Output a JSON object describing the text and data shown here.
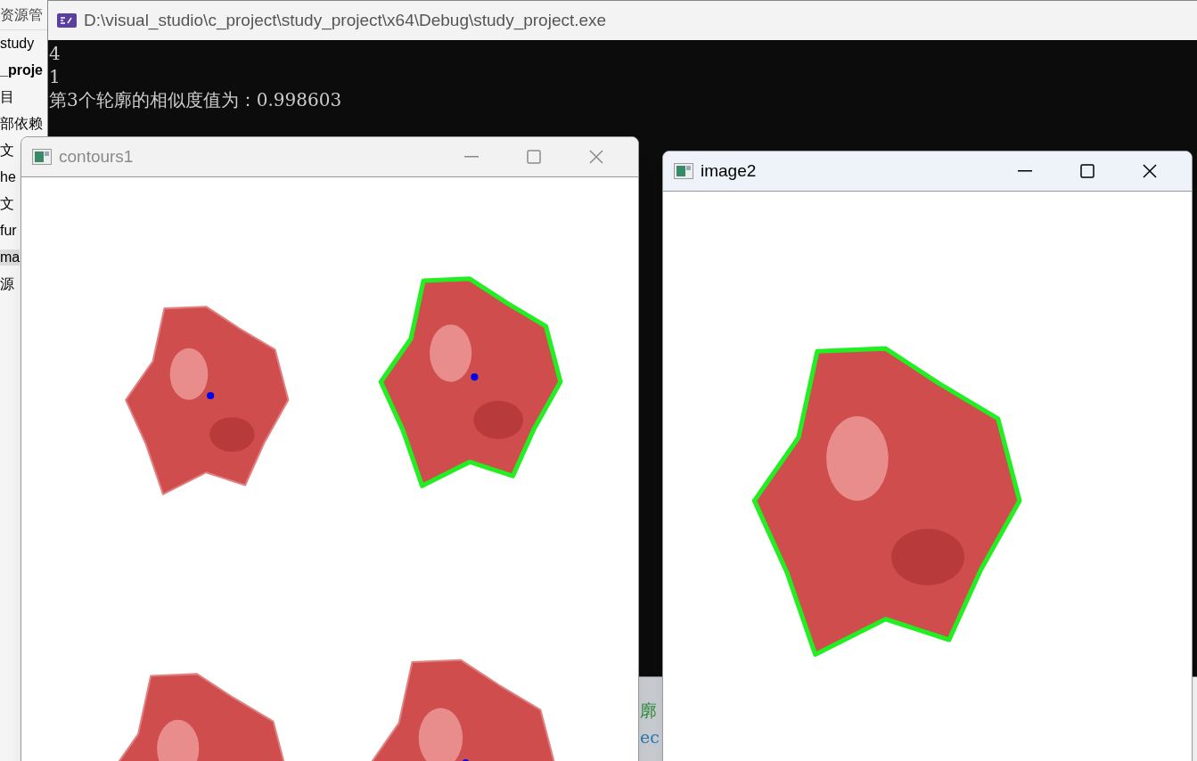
{
  "explorer": {
    "title": "资源管",
    "items": [
      {
        "label": "study",
        "bold": false,
        "selected": false
      },
      {
        "label": "_proje",
        "bold": true,
        "selected": false
      },
      {
        "label": "目",
        "bold": false,
        "selected": false
      },
      {
        "label": "部依赖",
        "bold": false,
        "selected": false
      },
      {
        "label": "文",
        "bold": false,
        "selected": false
      },
      {
        "label": "he",
        "bold": false,
        "selected": false
      },
      {
        "label": "文",
        "bold": false,
        "selected": false
      },
      {
        "label": "fur",
        "bold": false,
        "selected": false
      },
      {
        "label": "ma",
        "bold": false,
        "selected": true
      },
      {
        "label": "源",
        "bold": false,
        "selected": false
      }
    ]
  },
  "editor_fragment": {
    "lines": [
      "廓",
      "ec"
    ]
  },
  "console": {
    "title": "D:\\visual_studio\\c_project\\study_project\\x64\\Debug\\study_project.exe",
    "lines": [
      "4",
      "1",
      "第3个轮廓的相似度值为：0.998603"
    ]
  },
  "windows": [
    {
      "title": "contours1",
      "active": false
    },
    {
      "title": "image2",
      "active": true
    }
  ]
}
